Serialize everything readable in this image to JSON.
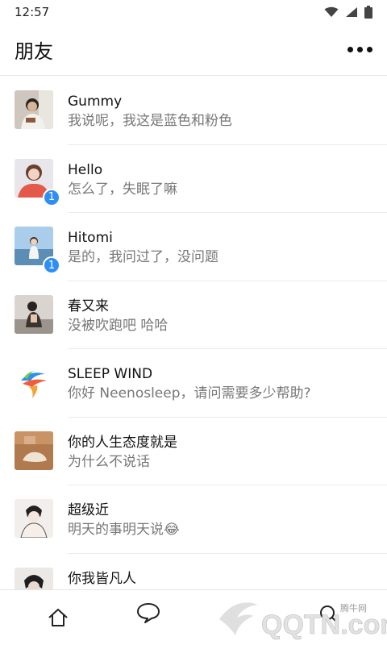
{
  "status_bar": {
    "time": "12:57"
  },
  "header": {
    "title": "朋友",
    "more_icon": "more-dots-icon"
  },
  "chats": [
    {
      "name": "Gummy",
      "message": "我说呢，我这是蓝色和粉色",
      "badge": ""
    },
    {
      "name": "Hello",
      "message": "怎么了，失眠了嘛",
      "badge": "1"
    },
    {
      "name": "Hitomi",
      "message": "是的，我问过了，没问题",
      "badge": "1"
    },
    {
      "name": "春又来",
      "message": "没被吹跑吧 哈哈",
      "badge": ""
    },
    {
      "name": "SLEEP WIND",
      "message": "你好 Neenosleep，请问需要多少帮助?",
      "badge": ""
    },
    {
      "name": "你的人生态度就是",
      "message": "为什么不说话",
      "badge": ""
    },
    {
      "name": "超级近",
      "message": "明天的事明天说😂",
      "badge": ""
    },
    {
      "name": "你我皆凡人",
      "message": "",
      "badge": ""
    }
  ],
  "tab_bar": {
    "icons": [
      "home-icon",
      "chat-icon",
      "search-icon"
    ]
  },
  "watermark": {
    "text": "QQTN.com",
    "sub_text": "腾牛网"
  },
  "colors": {
    "badge": "#2f8ef5",
    "divider": "#ececec",
    "secondary_text": "#777777"
  }
}
